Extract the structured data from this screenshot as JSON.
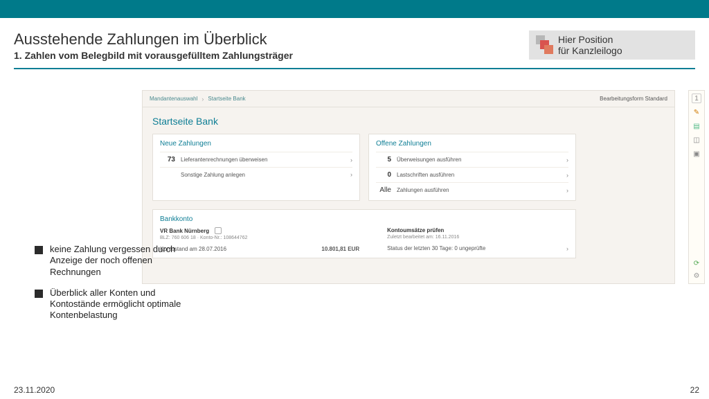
{
  "header": {
    "title": "Ausstehende Zahlungen im Überblick",
    "subtitle": "1. Zahlen vom Belegbild mit vorausgefülltem Zahlungsträger",
    "logo_text_1": "Hier Position",
    "logo_text_2": "für Kanzleilogo"
  },
  "breadcrumb": {
    "item1": "Mandantenauswahl",
    "item2": "Startseite Bank",
    "right": "Bearbeitungsform Standard"
  },
  "bank": {
    "page_title": "Startseite Bank",
    "neue_title": "Neue Zahlungen",
    "neue_row1_num": "73",
    "neue_row1_label": "Lieferantenrechnungen überweisen",
    "neue_row2_label": "Sonstige Zahlung anlegen",
    "offene_title": "Offene Zahlungen",
    "offene_row1_num": "5",
    "offene_row1_label": "Überweisungen ausführen",
    "offene_row2_num": "0",
    "offene_row2_label": "Lastschriften ausführen",
    "offene_row3_num": "Alle",
    "offene_row3_label": "Zahlungen ausführen",
    "bankkonto_title": "Bankkonto",
    "bank_name": "VR Bank Nürnberg",
    "bank_detail": "BLZ: 760 606 18 · Konto-Nr.: 108644762",
    "kontostand_label": "Kontostand am 28.07.2016",
    "kontostand_value": "10.801,81 EUR",
    "umsaetze_title": "Kontoumsätze prüfen",
    "umsaetze_detail": "Zuletzt bearbeitet am: 16.11.2016",
    "umsaetze_status": "Status der letzten 30 Tage: 0 ungeprüfte"
  },
  "bullets": {
    "b1": "keine Zahlung vergessen durch Anzeige der noch offenen Rechnungen",
    "b2": "Überblick aller Konten und Kontostände ermöglicht optimale Kontenbelastung"
  },
  "footer": {
    "date": "23.11.2020",
    "page": "22"
  }
}
